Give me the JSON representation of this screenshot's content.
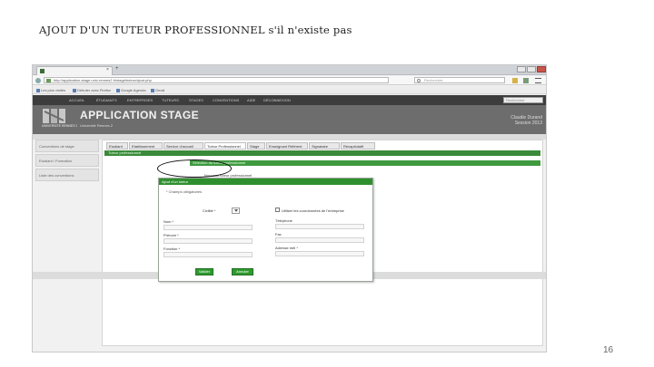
{
  "slide": {
    "title": "AJOUT D'UN TUTEUR PROFESSIONNEL s'il n'existe pas",
    "page_number": "16"
  },
  "browser": {
    "tab_title": "GEL Stage",
    "tab_close": "×",
    "tab_new": "+",
    "url": "http://application-stage.univ-rennes2.fr/stage/tuteur/ajout.php",
    "search_placeholder": "Rechercher",
    "bookmarks": [
      "Les plus visités",
      "Débuter avec Firefox",
      "Google Agenda",
      "Gmail"
    ]
  },
  "site": {
    "top_nav": [
      "ACCUEIL",
      "ÉTUDIANTS",
      "ENTREPRISES",
      "TUTEURS",
      "STAGES",
      "CONVENTIONS",
      "AIDE",
      "DÉCONNEXION"
    ],
    "search_placeholder": "Rechercher",
    "app_title": "APPLICATION STAGE",
    "app_subtitle": "Université Rennes 2",
    "logo_text": "UNIVERSITÉ RENNES 2",
    "user_name": "Claudie Durand",
    "user_role": "Session 2013"
  },
  "sidebar": {
    "items": [
      "Conventions de stage",
      "Etudiant / Formation",
      "Liste des conventions"
    ]
  },
  "main": {
    "subtabs": [
      "Etudiant",
      "Etablissement",
      "Service d'accueil",
      "Tuteur Professionnel",
      "Stage",
      "Enseignant Référent",
      "Signataire",
      "Récapitulatif"
    ],
    "green_bar_1": "Tuteur professionnel",
    "green_bar_2": "Sélection du tuteur professionnel",
    "new_tutor_link": "Nouveau tuteur professionnel"
  },
  "modal": {
    "title": "Ajout d'un tuteur",
    "required_note": "* Champs obligatoires",
    "civility_label": "Civilité *",
    "name_label": "Nom *",
    "firstname_label": "Prénom *",
    "function_label": "Fonction *",
    "use_company_coords": "Utiliser les coordonnées de l'entreprise",
    "phone_label": "Téléphone",
    "fax_label": "Fax",
    "email_label": "Adresse mél *",
    "submit_label": "Valider",
    "cancel_label": "Annuler"
  },
  "colors": {
    "accent_green": "#2e9a2e",
    "banner_gray": "#6d6d6d",
    "nav_dark": "#3d3d3d"
  }
}
